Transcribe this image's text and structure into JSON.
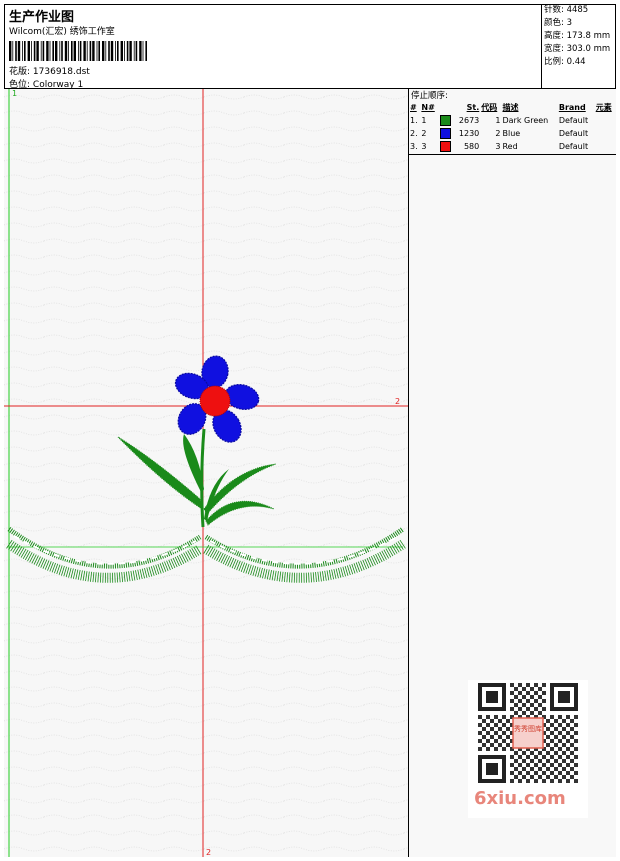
{
  "header": {
    "title": "生产作业图",
    "company": "Wilcom(汇宏) 绣饰工作室",
    "design_label": "花版:",
    "design_value": "1736918.dst",
    "colorway_label": "色位:",
    "colorway_value": "Colorway 1"
  },
  "specs": {
    "stitches_label": "针数:",
    "stitches_value": "4485",
    "colors_label": "颜色:",
    "colors_value": "3",
    "height_label": "高度:",
    "height_value": "173.8 mm",
    "width_label": "宽度:",
    "width_value": "303.0 mm",
    "scale_label": "比例:",
    "scale_value": "0.44"
  },
  "canvas": {
    "marker_top_left": "1",
    "marker_right": "2",
    "marker_bottom": "2"
  },
  "stop_sequence": {
    "title": "停止顺序:",
    "columns": [
      "#",
      "N#",
      "St.",
      "代码",
      "描述",
      "Brand",
      "元素"
    ],
    "rows": [
      {
        "idx": "1.",
        "n": "1",
        "color": "#1a8a1a",
        "st": "2673",
        "code": "1",
        "desc": "Dark Green",
        "brand": "Default"
      },
      {
        "idx": "2.",
        "n": "2",
        "color": "#1010e0",
        "st": "1230",
        "code": "2",
        "desc": "Blue",
        "brand": "Default"
      },
      {
        "idx": "3.",
        "n": "3",
        "color": "#ee1010",
        "st": "580",
        "code": "3",
        "desc": "Red",
        "brand": "Default"
      }
    ]
  },
  "watermark": {
    "qr_label": "秀秀图库",
    "site": "6xiu.com"
  },
  "colors": {
    "green": "#1a8a1a",
    "blue": "#1010e0",
    "red": "#ee1010",
    "guide_red": "#e02020",
    "guide_green": "#22cc22"
  }
}
